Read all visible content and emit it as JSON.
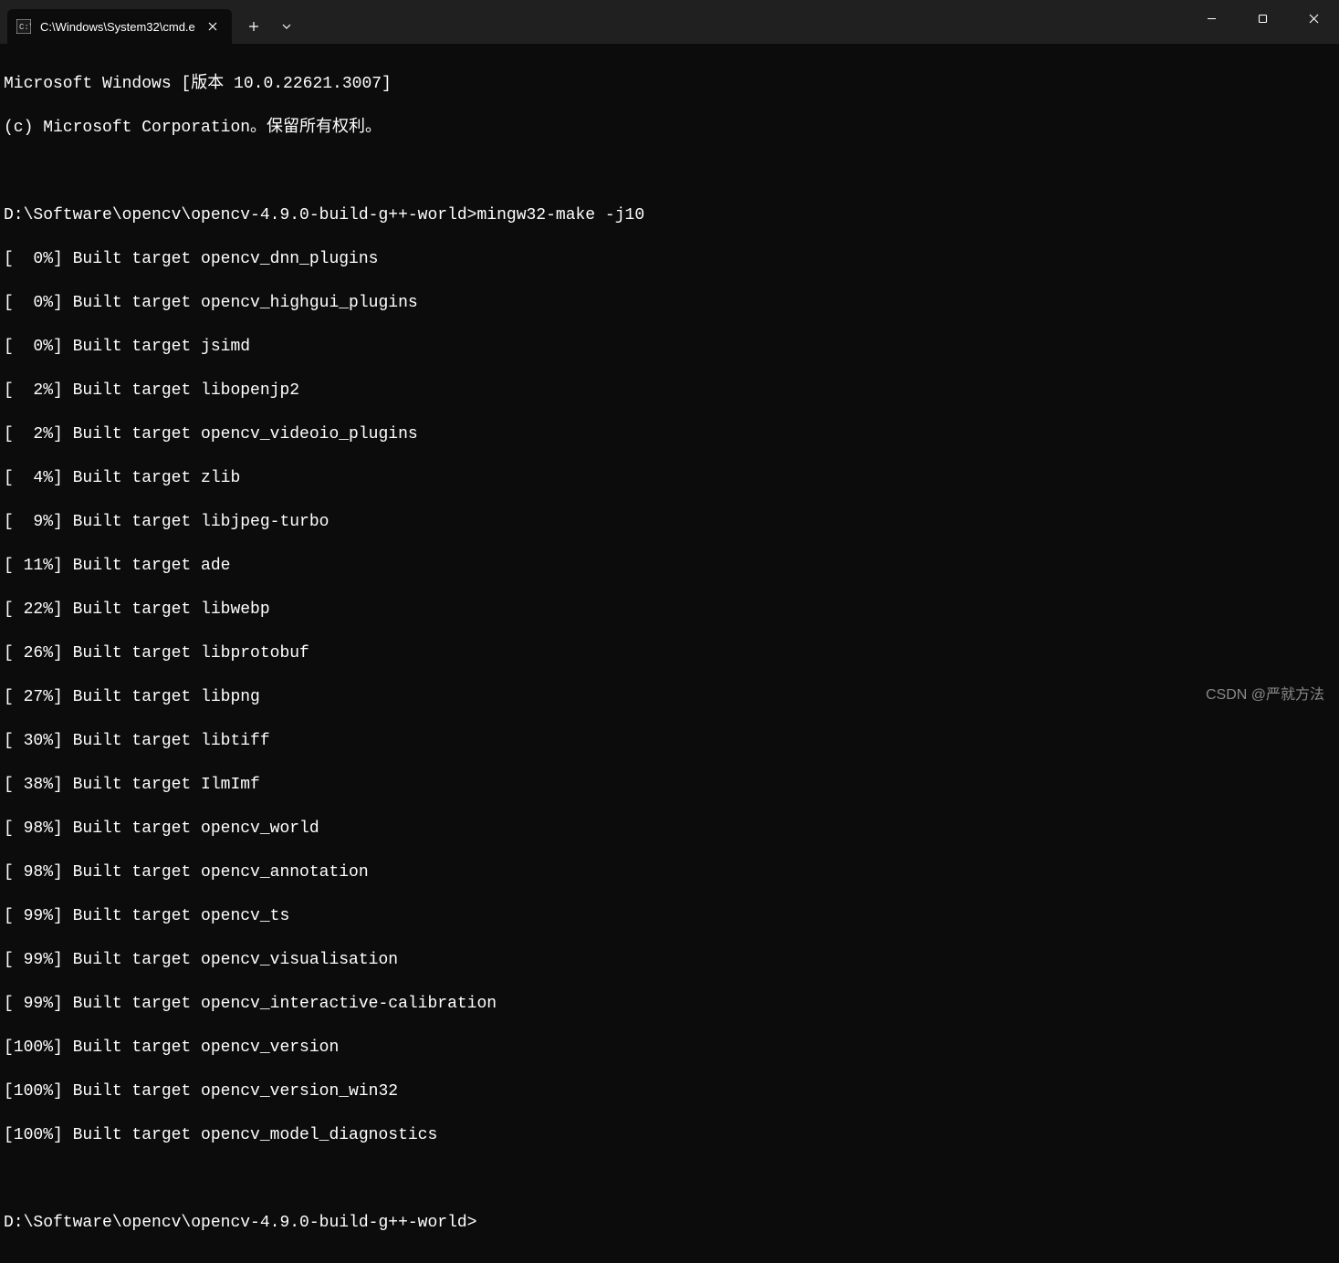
{
  "titlebar": {
    "tab_title": "C:\\Windows\\System32\\cmd.e"
  },
  "terminal": {
    "header_line1": "Microsoft Windows [版本 10.0.22621.3007]",
    "header_line2": "(c) Microsoft Corporation。保留所有权利。",
    "prompt1": "D:\\Software\\opencv\\opencv-4.9.0-build-g++-world>mingw32-make -j10",
    "build_lines": [
      "[  0%] Built target opencv_dnn_plugins",
      "[  0%] Built target opencv_highgui_plugins",
      "[  0%] Built target jsimd",
      "[  2%] Built target libopenjp2",
      "[  2%] Built target opencv_videoio_plugins",
      "[  4%] Built target zlib",
      "[  9%] Built target libjpeg-turbo",
      "[ 11%] Built target ade",
      "[ 22%] Built target libwebp",
      "[ 26%] Built target libprotobuf",
      "[ 27%] Built target libpng",
      "[ 30%] Built target libtiff",
      "[ 38%] Built target IlmImf",
      "[ 98%] Built target opencv_world",
      "[ 98%] Built target opencv_annotation",
      "[ 99%] Built target opencv_ts",
      "[ 99%] Built target opencv_visualisation",
      "[ 99%] Built target opencv_interactive-calibration",
      "[100%] Built target opencv_version",
      "[100%] Built target opencv_version_win32",
      "[100%] Built target opencv_model_diagnostics"
    ],
    "prompt2": "D:\\Software\\opencv\\opencv-4.9.0-build-g++-world>"
  },
  "watermark": "CSDN @严就方法"
}
